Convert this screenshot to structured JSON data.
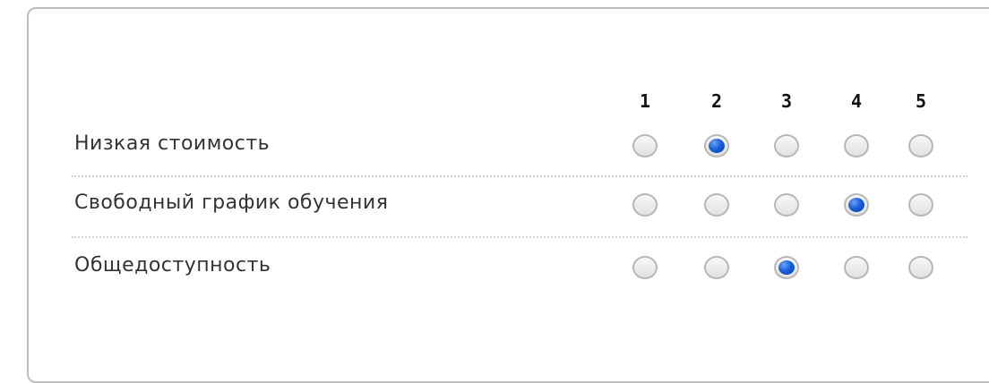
{
  "scale": {
    "columns": [
      "1",
      "2",
      "3",
      "4",
      "5"
    ]
  },
  "rows": [
    {
      "label": "Низкая стоимость",
      "selected": "2"
    },
    {
      "label": "Свободный график обучения",
      "selected": "4"
    },
    {
      "label": "Общедоступность",
      "selected": "3"
    }
  ],
  "colors": {
    "selected_radio": "#0b4fd6",
    "border": "#bdbdbd",
    "text": "#333333"
  }
}
